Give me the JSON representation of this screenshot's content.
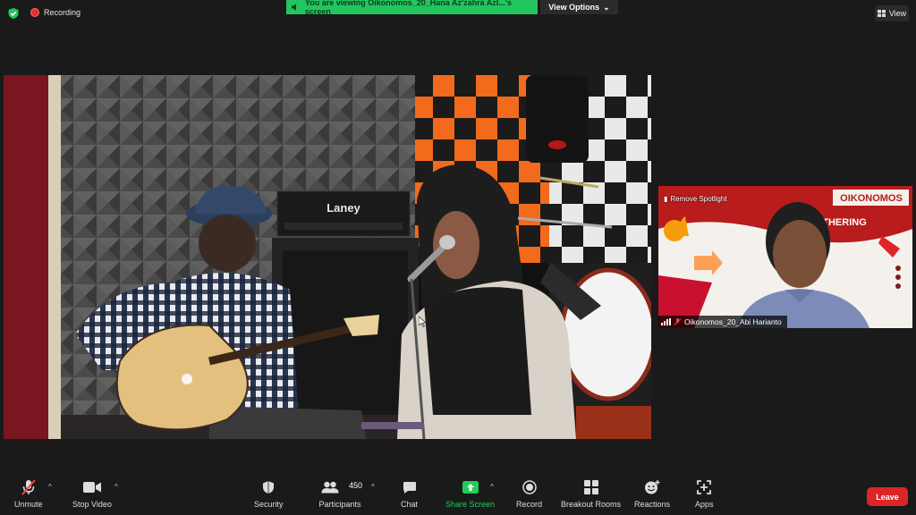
{
  "status": {
    "recording_label": "Recording"
  },
  "banner": {
    "text": "You are viewing Oikonomos_20_Hana Az'zahra Azl...'s screen"
  },
  "view_options": {
    "label": "View Options"
  },
  "view_button": {
    "label": "View"
  },
  "shared_screen": {
    "amp_brand": "Laney"
  },
  "spotlight": {
    "remove_label": "Remove Spotlight",
    "participant_name": "Oikonomos_20_Abi Harianto",
    "bg_text_1": "OIKONOMOS",
    "bg_text_2": "THERING"
  },
  "toolbar": {
    "unmute": "Unmute",
    "stop_video": "Stop Video",
    "security": "Security",
    "participants": "Participants",
    "participants_count": "450",
    "chat": "Chat",
    "share_screen": "Share Screen",
    "record": "Record",
    "breakout_rooms": "Breakout Rooms",
    "reactions": "Reactions",
    "apps": "Apps",
    "leave": "Leave"
  },
  "colors": {
    "share_green": "#22c55e",
    "leave_red": "#dc2626",
    "record_red": "#e02f2f"
  }
}
